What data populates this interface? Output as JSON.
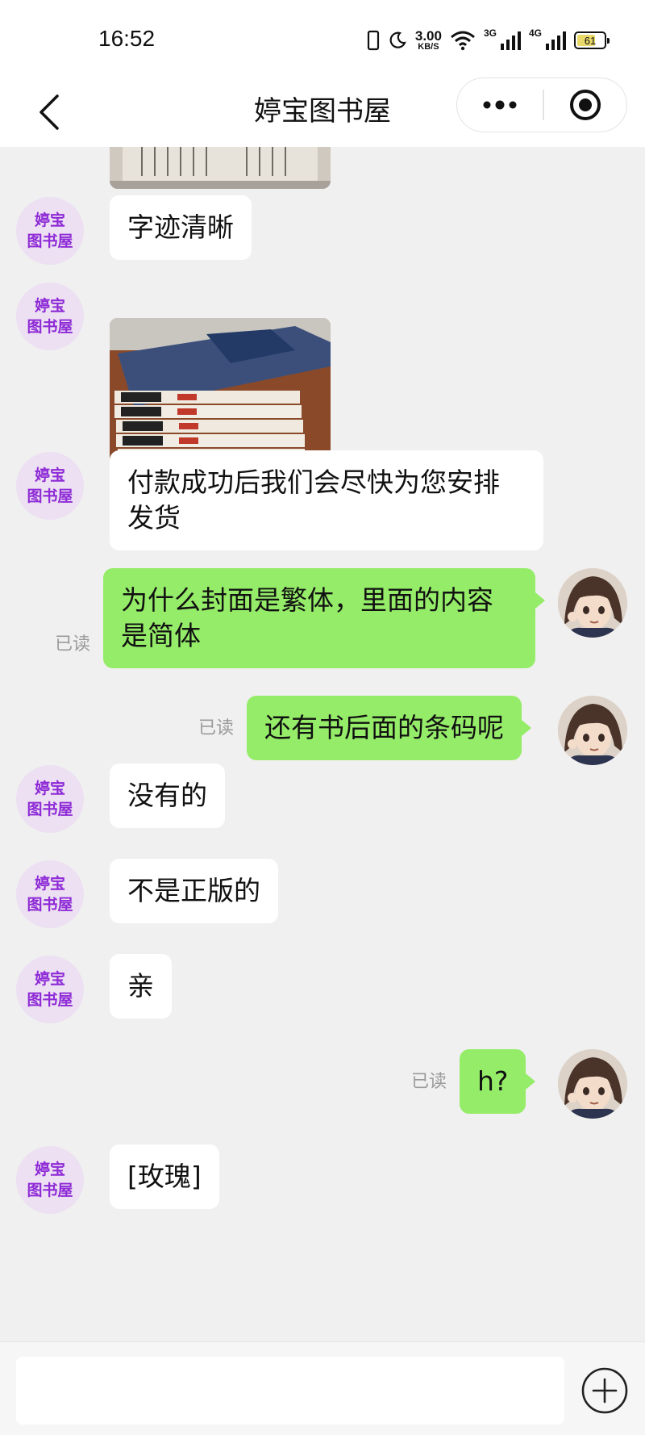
{
  "status_bar": {
    "time": "16:52",
    "net_speed_value": "3.00",
    "net_speed_unit": "KB/S",
    "sig1_label": "3G",
    "sig2_label": "4G",
    "battery": "61"
  },
  "header": {
    "title": "婷宝图书屋"
  },
  "shop": {
    "avatar_line1": "婷宝",
    "avatar_line2": "图书屋"
  },
  "messages": [
    {
      "text": "字迹清晰"
    },
    {
      "text": "付款成功后我们会尽快为您安排\n发货"
    },
    {
      "text": "为什么封面是繁体，里面的内容\n是简体",
      "read": "已读"
    },
    {
      "text": "还有书后面的条码呢",
      "read": "已读"
    },
    {
      "text": "没有的"
    },
    {
      "text": "不是正版的"
    },
    {
      "text": "亲"
    },
    {
      "text": "h?",
      "read": "已读"
    },
    {
      "text": "[玫瑰]"
    }
  ],
  "input": {
    "value": ""
  },
  "colors": {
    "my_bubble": "#95ec69",
    "their_bubble": "#ffffff",
    "shop_avatar_text": "#8e2ad6",
    "background": "#f0f0f0"
  }
}
